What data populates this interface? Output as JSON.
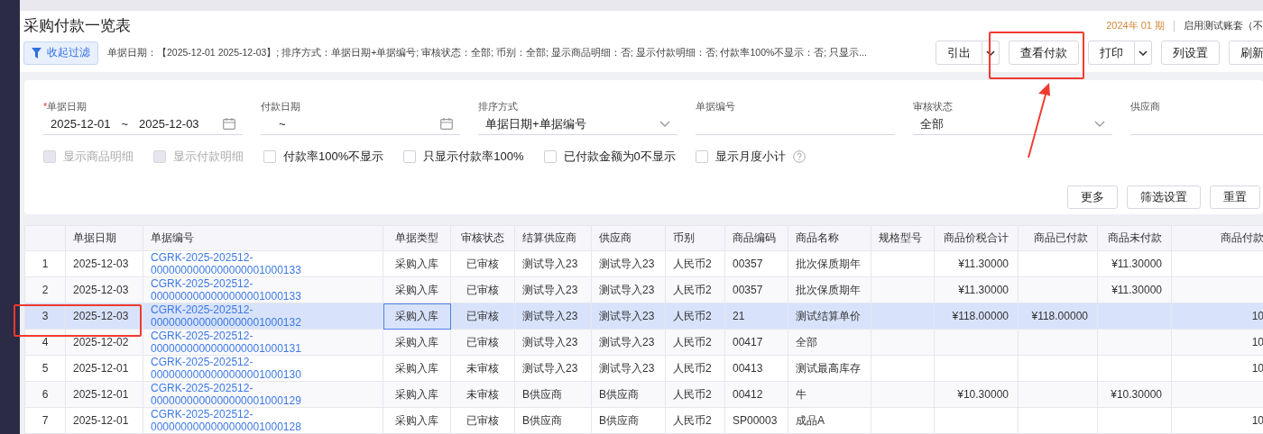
{
  "header": {
    "title": "采购付款一览表",
    "period": "2024年 01 期",
    "account": "启用测试账套（不"
  },
  "filter_toggle": {
    "label": "收起过滤"
  },
  "filter_summary": "单据日期：【2025-12-01 2025-12-03】; 排序方式：单据日期+单据编号; 审核状态：全部; 币别：全部; 显示商品明细：否; 显示付款明细：否; 付款率100%不显示：否; 只显示...",
  "toolbar": [
    {
      "label": "引出",
      "kind": "split"
    },
    {
      "label": "查看付款",
      "kind": "plain",
      "highlighted": true
    },
    {
      "label": "打印",
      "kind": "split"
    },
    {
      "label": "列设置",
      "kind": "plain"
    },
    {
      "label": "刷新",
      "kind": "plain"
    }
  ],
  "fields": [
    {
      "label": "单据日期",
      "required_mark": "*",
      "kind": "date_range",
      "from": "2025-12-01",
      "to": "2025-12-03",
      "separator": "~"
    },
    {
      "label": "付款日期",
      "kind": "date_range",
      "separator": "~"
    },
    {
      "label": "排序方式",
      "kind": "select",
      "value": "单据日期+单据编号"
    },
    {
      "label": "单据编号",
      "kind": "text"
    },
    {
      "label": "审核状态",
      "kind": "select",
      "value": "全部"
    },
    {
      "label": "供应商",
      "kind": "text"
    }
  ],
  "options": [
    {
      "label": "显示商品明细",
      "checked": false,
      "disabled": true
    },
    {
      "label": "显示付款明细",
      "checked": false,
      "disabled": true
    },
    {
      "label": "付款率100%不显示",
      "checked": false,
      "disabled": false
    },
    {
      "label": "只显示付款率100%",
      "checked": false,
      "disabled": false
    },
    {
      "label": "已付款金额为0不显示",
      "checked": false,
      "disabled": false
    },
    {
      "label": "显示月度小计",
      "checked": false,
      "disabled": false,
      "help": true
    }
  ],
  "filter_buttons": [
    "更多",
    "筛选设置",
    "重置"
  ],
  "table": {
    "columns": [
      "",
      "单据日期",
      "单据编号",
      "单据类型",
      "审核状态",
      "结算供应商",
      "供应商",
      "币别",
      "商品编码",
      "商品名称",
      "规格型号",
      "商品价税合计",
      "商品已付款",
      "商品未付款",
      "商品付款"
    ],
    "rows": [
      {
        "selected": false,
        "cells": [
          "1",
          "2025-12-03",
          "CGRK-2025-202512-0000000000000000001000133",
          "采购入库",
          "已审核",
          "测试导入23",
          "测试导入23",
          "人民币2",
          "00357",
          "批次保质期年",
          "",
          "¥11.30000",
          "",
          "¥11.30000",
          ""
        ]
      },
      {
        "selected": false,
        "cells": [
          "2",
          "2025-12-03",
          "CGRK-2025-202512-0000000000000000001000133",
          "采购入库",
          "已审核",
          "测试导入23",
          "测试导入23",
          "人民币2",
          "00357",
          "批次保质期年",
          "",
          "¥11.30000",
          "",
          "¥11.30000",
          ""
        ]
      },
      {
        "selected": true,
        "highlighted": true,
        "cells": [
          "3",
          "2025-12-03",
          "CGRK-2025-202512-0000000000000000001000132",
          "采购入库",
          "已审核",
          "测试导入23",
          "测试导入23",
          "人民币2",
          "21",
          "测试结算单价",
          "",
          "¥118.00000",
          "¥118.00000",
          "",
          "10"
        ]
      },
      {
        "selected": false,
        "cells": [
          "4",
          "2025-12-02",
          "CGRK-2025-202512-0000000000000000001000131",
          "采购入库",
          "已审核",
          "测试导入23",
          "测试导入23",
          "人民币2",
          "00417",
          "全部",
          "",
          "",
          "",
          "",
          "10"
        ]
      },
      {
        "selected": false,
        "cells": [
          "5",
          "2025-12-01",
          "CGRK-2025-202512-0000000000000000001000130",
          "采购入库",
          "未审核",
          "测试导入23",
          "测试导入23",
          "人民币2",
          "00413",
          "测试最高库存",
          "",
          "",
          "",
          "",
          "10"
        ]
      },
      {
        "selected": false,
        "cells": [
          "6",
          "2025-12-01",
          "CGRK-2025-202512-0000000000000000001000129",
          "采购入库",
          "未审核",
          "B供应商",
          "B供应商",
          "人民币2",
          "00412",
          "牛",
          "",
          "¥10.30000",
          "",
          "¥10.30000",
          ""
        ]
      },
      {
        "selected": false,
        "cells": [
          "7",
          "2025-12-01",
          "CGRK-2025-202512-0000000000000000001000128",
          "采购入库",
          "已审核",
          "B供应商",
          "B供应商",
          "人民币2",
          "SP00003",
          "成品A",
          "",
          "",
          "",
          "",
          "10"
        ]
      }
    ]
  }
}
